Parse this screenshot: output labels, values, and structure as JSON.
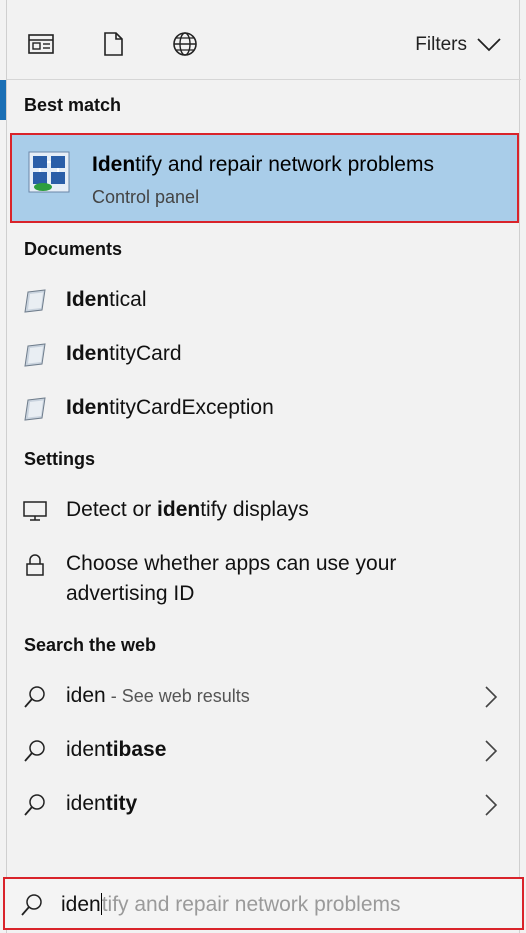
{
  "toolbar": {
    "filters_label": "Filters",
    "icons": [
      "apps-icon",
      "documents-icon",
      "web-icon"
    ]
  },
  "best_match": {
    "heading": "Best match",
    "title_bold": "Iden",
    "title_rest": "tify and repair network problems",
    "subtitle": "Control panel",
    "icon": "network-troubleshooter-icon"
  },
  "documents": {
    "heading": "Documents",
    "items": [
      {
        "bold": "Iden",
        "rest": "tical"
      },
      {
        "bold": "Iden",
        "rest": "tityCard"
      },
      {
        "bold": "Iden",
        "rest": "tityCardException"
      }
    ]
  },
  "settings": {
    "heading": "Settings",
    "items": [
      {
        "pre": "Detect or ",
        "bold": "iden",
        "rest": "tify displays",
        "icon": "monitor-icon"
      },
      {
        "pre": "Choose whether apps can use your advertising ID",
        "bold": "",
        "rest": "",
        "icon": "lock-icon"
      }
    ]
  },
  "web": {
    "heading": "Search the web",
    "items": [
      {
        "pre": "iden",
        "bold": "",
        "light": " - See web results"
      },
      {
        "pre": "iden",
        "bold": "tibase",
        "light": ""
      },
      {
        "pre": "iden",
        "bold": "tity",
        "light": ""
      }
    ]
  },
  "search": {
    "typed": "iden",
    "suggestion": "tify and repair network problems"
  },
  "colors": {
    "highlight": "#a9cde9",
    "focus_border": "#d9232a",
    "panel_bg": "#f2f2f2"
  }
}
